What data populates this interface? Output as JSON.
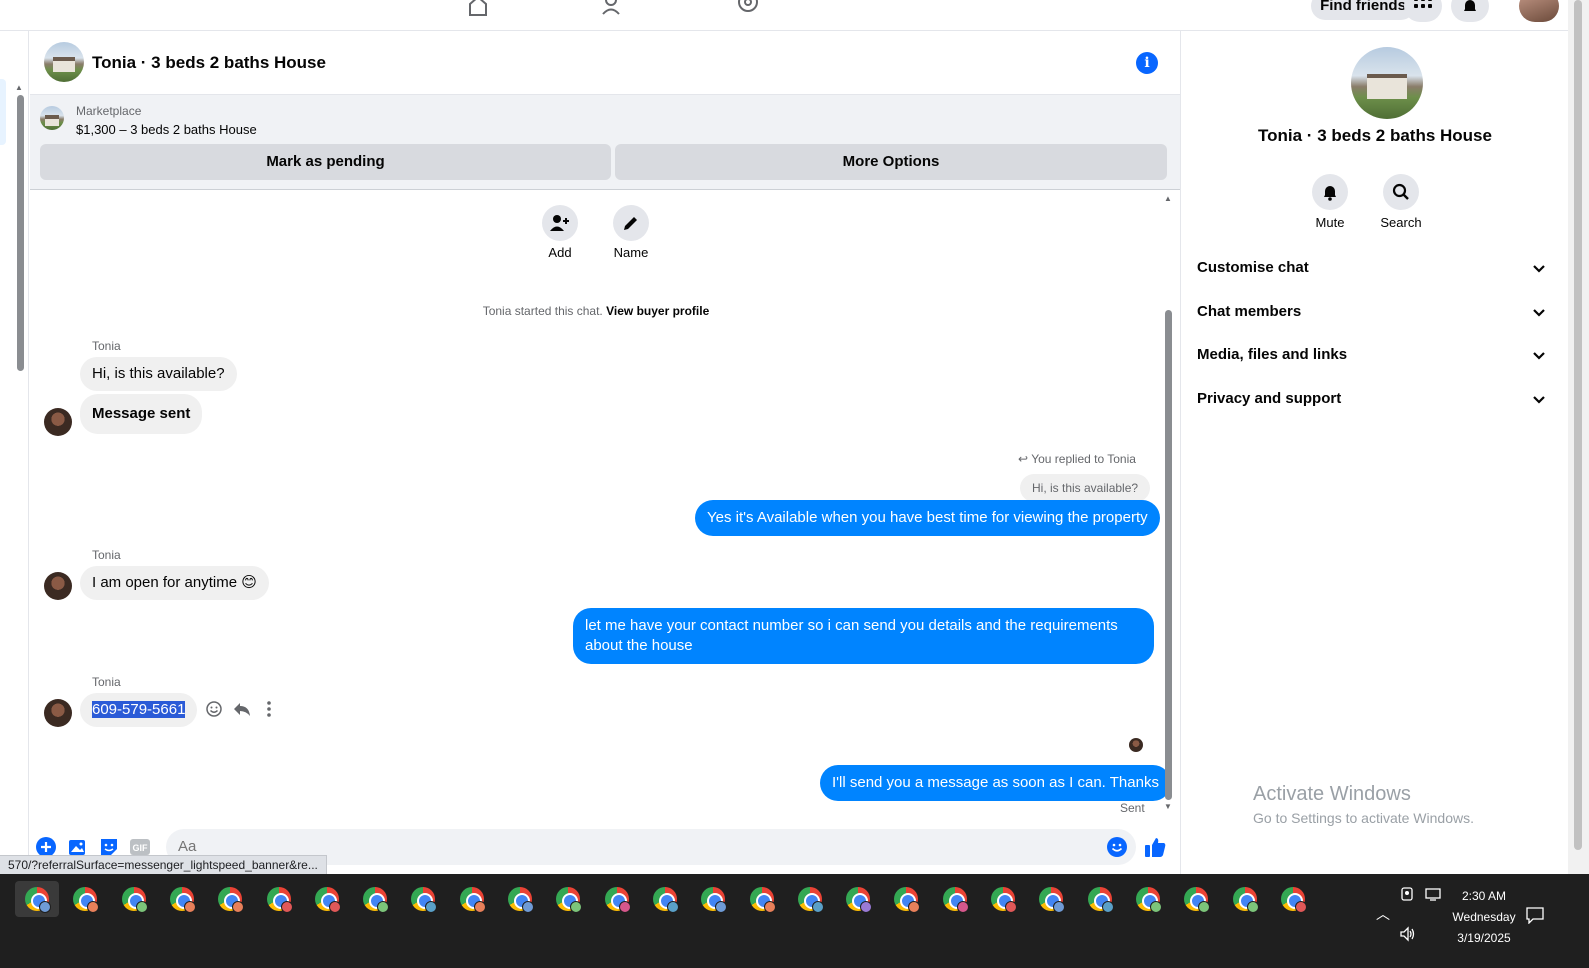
{
  "topnav": {
    "find_friends": "Find friends"
  },
  "chat": {
    "title": "Tonia · 3 beds 2 baths House",
    "marketplace_label": "Marketplace",
    "listing": "$1,300 – 3 beds 2 baths House",
    "mark_pending": "Mark as pending",
    "more_options": "More Options",
    "actions": [
      {
        "label": "Add",
        "icon": "add-person-icon"
      },
      {
        "label": "Name",
        "icon": "pencil-icon"
      }
    ],
    "started_text": "Tonia started this chat.",
    "view_profile": "View buyer profile"
  },
  "messages": {
    "sender_name": "Tonia",
    "m1": "Hi, is this available?",
    "m2": "Message sent",
    "reply_note": "You replied to Tonia",
    "quoted": "Hi, is this available?",
    "m3": "Yes it's Available when you have best time for viewing the property",
    "m4": "I am open for anytime 😊",
    "m5": "let me have your contact number so i can send you details and the requirements about the house",
    "m6": "609-579-5661",
    "m7": "I'll send you a message as soon as I can. Thanks",
    "sent": "Sent"
  },
  "composer": {
    "placeholder": "Aa"
  },
  "status_url": "570/?referralSurface=messenger_lightspeed_banner&re...",
  "rpanel": {
    "title": "Tonia · 3 beds 2 baths House",
    "mute": "Mute",
    "search": "Search",
    "sections": [
      "Customise chat",
      "Chat members",
      "Media, files and links",
      "Privacy and support"
    ],
    "activate_title": "Activate Windows",
    "activate_sub": "Go to Settings to activate Windows."
  },
  "taskbar": {
    "time": "2:30 AM",
    "day": "Wednesday",
    "date": "3/19/2025",
    "badge_colors": [
      "#6f9bd6",
      "#e8805a",
      "#7cc47a",
      "#e8805a",
      "#e8805a",
      "#e05858",
      "#e05858",
      "#7cc47a",
      "#5aa0c8",
      "#e8805a",
      "#6f9bd6",
      "#7cc47a",
      "#d6578c",
      "#5aa0c8",
      "#6f9bd6",
      "#e8805a",
      "#5aa0c8",
      "#9a7ad6",
      "#e8805a",
      "#d6578c",
      "#e05858",
      "#6f9bd6",
      "#5aa0c8",
      "#7cc47a",
      "#7cc47a",
      "#7cc47a",
      "#e05858"
    ]
  },
  "colors": {
    "accent": "#0866ff",
    "bubble_out": "#0084ff"
  }
}
